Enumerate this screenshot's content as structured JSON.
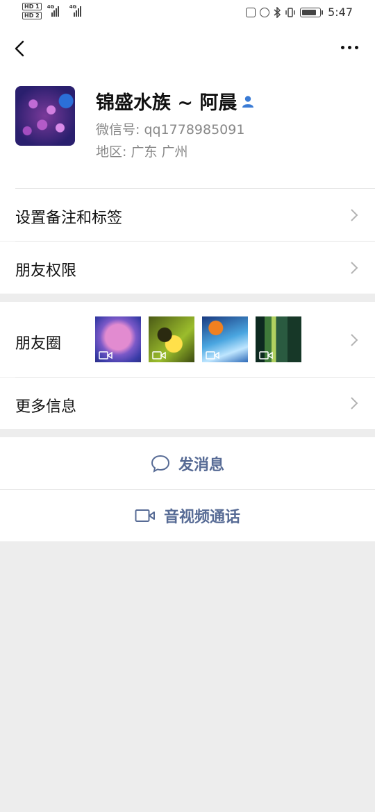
{
  "status_bar": {
    "hd1": "HD 1",
    "hd2": "HD 2",
    "network1": "4G",
    "network2": "4G",
    "time": "5:47"
  },
  "nav": {
    "back_icon": "chevron-left-icon",
    "more_icon": "ellipsis-icon"
  },
  "profile": {
    "name": "锦盛水族 ~ 阿晨",
    "wechat_id": "微信号:  qq1778985091",
    "region": "地区:  广东  广州"
  },
  "rows": {
    "remark": "设置备注和标签",
    "permissions": "朋友权限",
    "moments": "朋友圈",
    "more_info": "更多信息"
  },
  "actions": {
    "message": "发消息",
    "call": "音视频通话"
  },
  "colors": {
    "link": "#576b95",
    "background": "#ededed",
    "contact_icon": "#3a7bd5"
  }
}
